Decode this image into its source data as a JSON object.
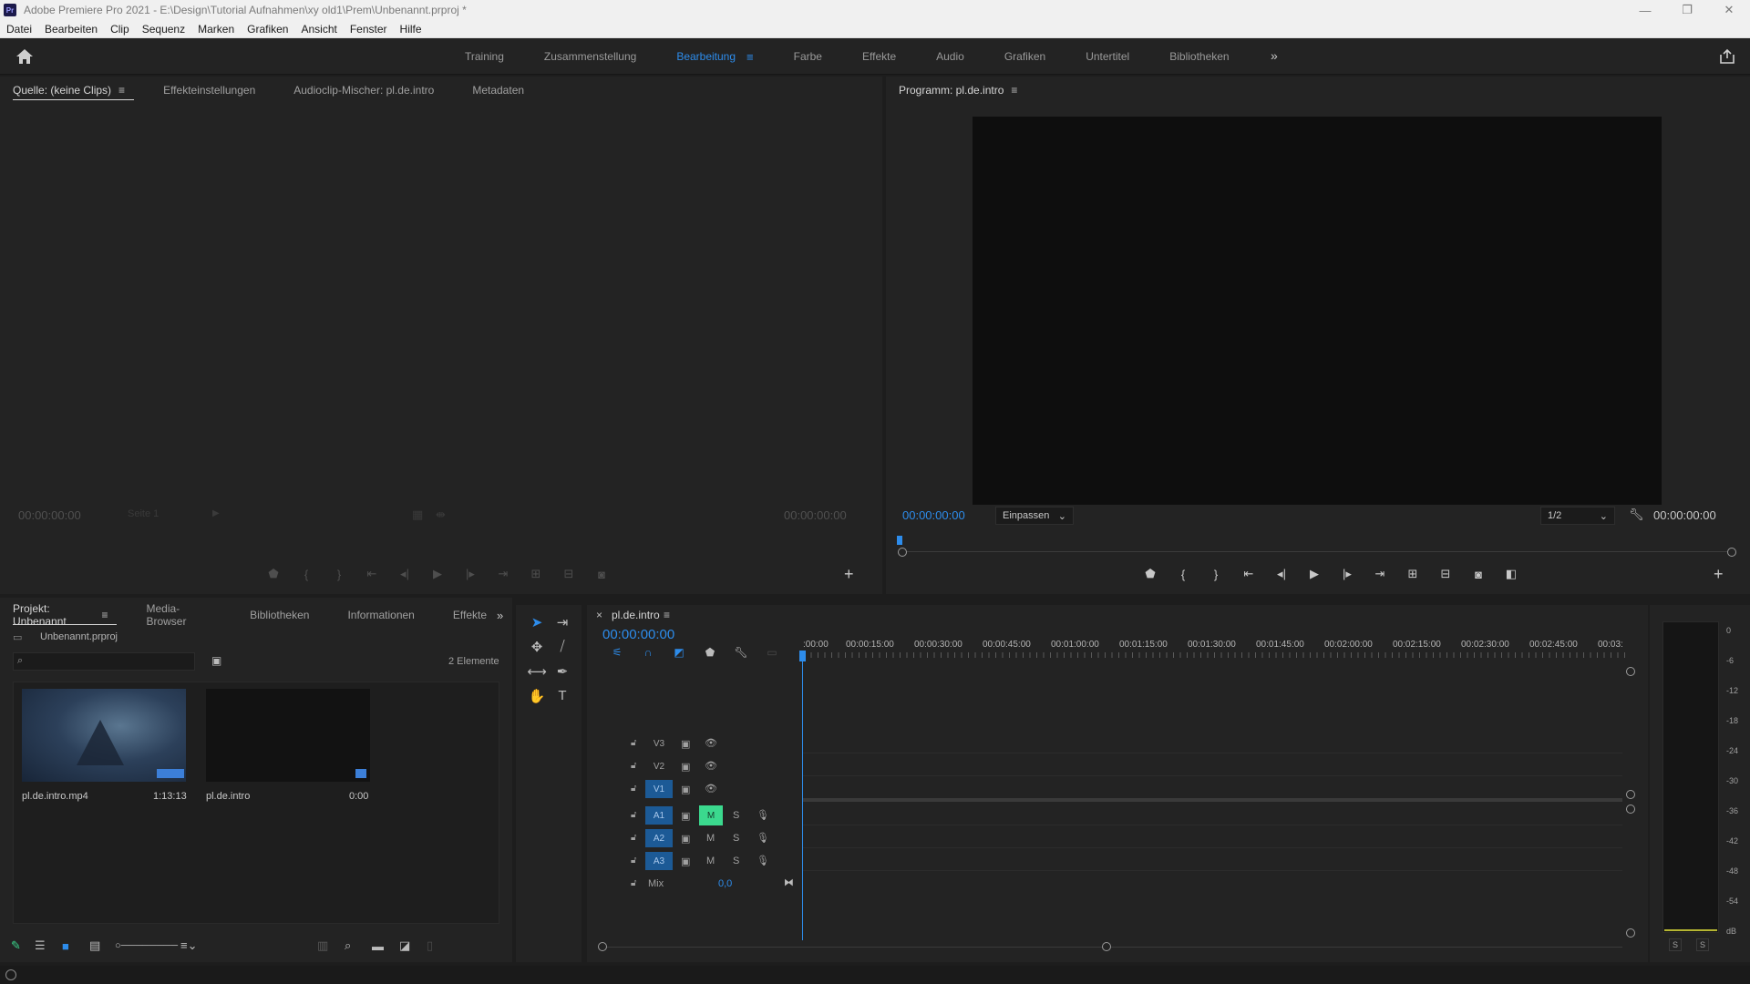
{
  "window": {
    "app_logo": "Pr",
    "title": "Adobe Premiere Pro 2021 - E:\\Design\\Tutorial Aufnahmen\\xy old1\\Prem\\Unbenannt.prproj *",
    "controls": [
      "—",
      "❐",
      "✕"
    ]
  },
  "menu": [
    "Datei",
    "Bearbeiten",
    "Clip",
    "Sequenz",
    "Marken",
    "Grafiken",
    "Ansicht",
    "Fenster",
    "Hilfe"
  ],
  "workspaces": {
    "tabs": [
      {
        "label": "Training"
      },
      {
        "label": "Zusammenstellung"
      },
      {
        "label": "Bearbeitung",
        "active": true
      },
      {
        "label": "Farbe"
      },
      {
        "label": "Effekte"
      },
      {
        "label": "Audio"
      },
      {
        "label": "Grafiken"
      },
      {
        "label": "Untertitel"
      },
      {
        "label": "Bibliotheken"
      }
    ],
    "more": "»"
  },
  "source_panel": {
    "tabs": [
      "Quelle: (keine Clips)",
      "Effekteinstellungen",
      "Audioclip-Mischer: pl.de.intro",
      "Metadaten"
    ],
    "timecode_left": "00:00:00:00",
    "page_dropdown": "Seite 1",
    "timecode_right": "00:00:00:00"
  },
  "program_panel": {
    "tab": "Programm: pl.de.intro",
    "timecode": "00:00:00:00",
    "fit": "Einpassen",
    "resolution": "1/2",
    "duration": "00:00:00:00"
  },
  "project_panel": {
    "tabs": [
      "Projekt: Unbenannt",
      "Media-Browser",
      "Bibliotheken",
      "Informationen",
      "Effekte"
    ],
    "project_file": "Unbenannt.prproj",
    "item_count": "2 Elemente",
    "items": [
      {
        "name": "pl.de.intro.mp4",
        "duration": "1:13:13"
      },
      {
        "name": "pl.de.intro",
        "duration": "0:00"
      }
    ]
  },
  "timeline": {
    "sequence_tab": "pl.de.intro",
    "close": "×",
    "timecode": "00:00:00:00",
    "ruler": [
      ":00:00",
      "00:00:15:00",
      "00:00:30:00",
      "00:00:45:00",
      "00:01:00:00",
      "00:01:15:00",
      "00:01:30:00",
      "00:01:45:00",
      "00:02:00:00",
      "00:02:15:00",
      "00:02:30:00",
      "00:02:45:00",
      "00:03:"
    ],
    "video_tracks": [
      "V3",
      "V2",
      "V1"
    ],
    "audio_tracks": [
      "A1",
      "A2",
      "A3"
    ],
    "mute": "M",
    "solo": "S",
    "mix_label": "Mix",
    "mix_value": "0,0"
  },
  "audio_meter": {
    "labels": [
      "0",
      "-6",
      "-12",
      "-18",
      "-24",
      "-30",
      "-36",
      "-42",
      "-48",
      "-54",
      "dB"
    ],
    "solo_buttons": [
      "S",
      "S"
    ]
  },
  "colors": {
    "accent_blue": "#2d8ceb",
    "mute_active": "#3bd98e",
    "panel_bg": "#232323",
    "app_bg": "#1d1d1d"
  }
}
